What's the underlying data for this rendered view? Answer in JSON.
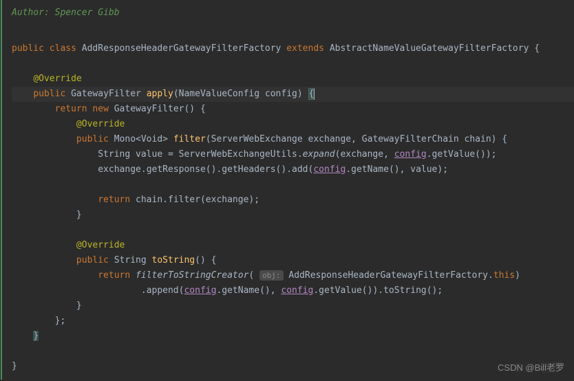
{
  "author_label": "Author: ",
  "author_name": "Spencer Gibb",
  "kw": {
    "public": "public",
    "class": "class",
    "extends": "extends",
    "return": "return",
    "new": "new",
    "this": "this"
  },
  "annotation": "@Override",
  "types": {
    "class_name": "AddResponseHeaderGatewayFilterFactory",
    "superclass": "AbstractNameValueGatewayFilterFactory",
    "gateway_filter": "GatewayFilter",
    "mono_void": "Mono<Void>",
    "string": "String",
    "swe": "ServerWebExchange",
    "gfc": "GatewayFilterChain",
    "nvc": "NameValueConfig"
  },
  "methods": {
    "apply": "apply",
    "filter": "filter",
    "to_string": "toString",
    "expand": "expand",
    "get_value": "getValue",
    "get_response": "getResponse",
    "get_headers": "getHeaders",
    "add": "add",
    "get_name": "getName",
    "chain_filter": "filter",
    "ftsc": "filterToStringCreator",
    "append": "append"
  },
  "params": {
    "config": "config",
    "exchange": "exchange",
    "chain": "chain",
    "value": "value"
  },
  "utils_class": "ServerWebExchangeUtils",
  "hint_obj": "obj:",
  "watermark": "CSDN @Bill老罗",
  "ghost_watermark": "Bill 老罗"
}
